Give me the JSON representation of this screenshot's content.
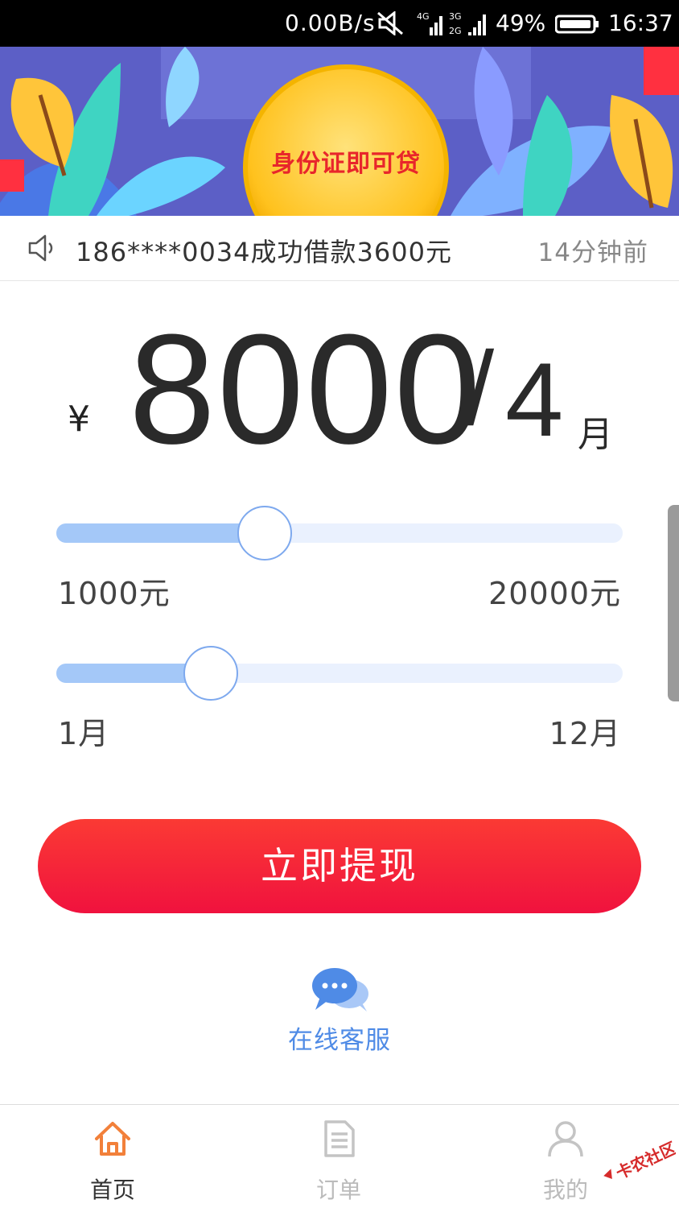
{
  "status_bar": {
    "net_speed": "0.00B/s",
    "battery": "49%",
    "time": "16:37",
    "icons": [
      "mute-icon",
      "signal-4g-icon",
      "signal-3g-2g-icon",
      "battery-icon"
    ]
  },
  "banner": {
    "text": "身份证即可贷"
  },
  "notice": {
    "message": "186****0034成功借款3600元",
    "time": "14分钟前"
  },
  "amount": {
    "currency": "¥",
    "value": "8000",
    "slash": "/",
    "months": "4",
    "unit": "月"
  },
  "amount_slider": {
    "min_label": "1000元",
    "max_label": "20000元",
    "min": 1000,
    "max": 20000,
    "value": 8000
  },
  "term_slider": {
    "min_label": "1月",
    "max_label": "12月",
    "min": 1,
    "max": 12,
    "value": 4
  },
  "cta_label": "立即提现",
  "service_label": "在线客服",
  "tabs": [
    {
      "label": "首页",
      "icon": "home-icon",
      "active": true
    },
    {
      "label": "订单",
      "icon": "document-icon",
      "active": false
    },
    {
      "label": "我的",
      "icon": "user-icon",
      "active": false
    }
  ],
  "colors": {
    "accent_red": "#f0123e",
    "slider_fill": "#a4c8f8",
    "link_blue": "#4f8be6",
    "active_tab": "#f2803a"
  }
}
